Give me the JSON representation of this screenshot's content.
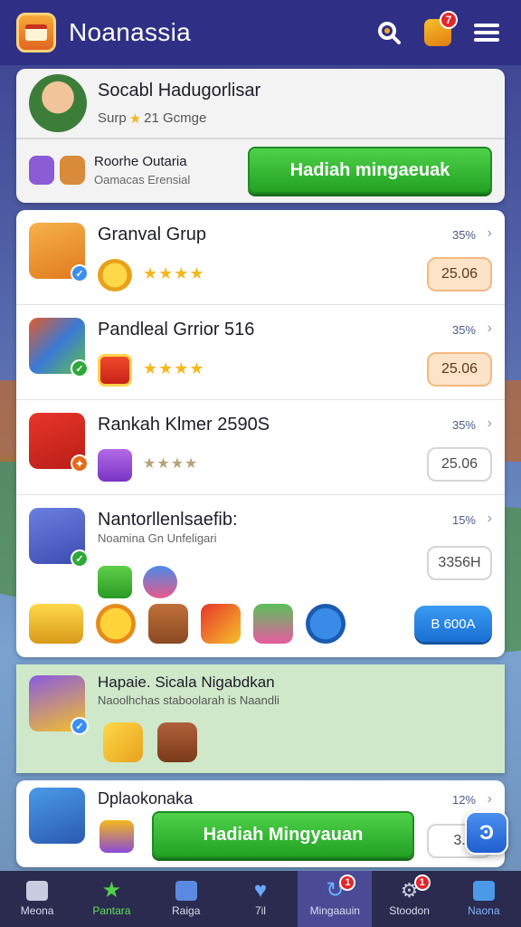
{
  "header": {
    "title": "Noanassia",
    "notification_count": "7"
  },
  "profile": {
    "name": "Socabl Hadugorlisar",
    "sub_prefix": "Surp",
    "sub_value": "21 Gcmge",
    "bonus_title": "Roorhe Outaria",
    "bonus_sub": "Oamacas Erensial",
    "bonus_button": "Hadiah mingaeuak"
  },
  "groups": [
    {
      "name": "Granval Grup",
      "percent": "35%",
      "price": "25.06",
      "stars": "★★★★"
    },
    {
      "name": "Pandleal Grrior 516",
      "percent": "35%",
      "price": "25.06",
      "stars": "★★★★"
    },
    {
      "name": "Rankah Klmer 2590S",
      "percent": "35%",
      "price": "25.06",
      "stars": "★★★★"
    },
    {
      "name": "Nantorllenlsaefib:",
      "sub": "Noamina Gn Unfeligari",
      "percent": "15%",
      "price": "3356H",
      "button": "B 600A"
    }
  ],
  "event": {
    "title": "Hapaie. Sicala Nigabdkan",
    "sub": "Naoolhchas staboolarah is Naandli"
  },
  "last_group": {
    "name": "Dplaokonaka",
    "percent": "12%",
    "button": "Hadiah Mingyauan",
    "price": "3."
  },
  "float_button": "Ͽ",
  "nav": [
    {
      "label": "Meona",
      "icon": "shop-icon"
    },
    {
      "label": "Pantara",
      "icon": "star-icon"
    },
    {
      "label": "Raiga",
      "icon": "book-icon"
    },
    {
      "label": "7il",
      "icon": "heart-icon"
    },
    {
      "label": "Mingaauin",
      "icon": "refresh-icon",
      "badge": "1"
    },
    {
      "label": "Stoodon",
      "icon": "gear-icon",
      "badge": "1"
    },
    {
      "label": "Naona",
      "icon": "bag-icon"
    }
  ],
  "colors": {
    "header_bg": "#2f2f86",
    "green_button": "#23a224",
    "blue_button": "#1a6fd4",
    "badge_red": "#e3262b",
    "nav_bg": "#2b2b4f"
  }
}
